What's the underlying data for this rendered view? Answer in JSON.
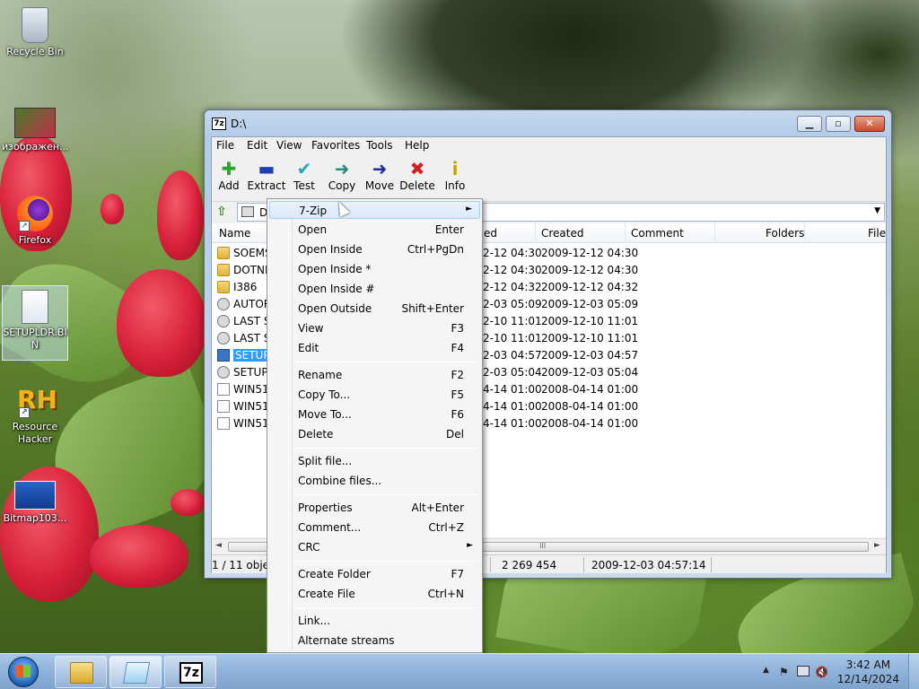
{
  "desktop": {
    "icons": [
      {
        "label": "Recycle Bin",
        "icon": "recycle-bin-icon"
      },
      {
        "label": "изображен...",
        "icon": "image-file-icon"
      },
      {
        "label": "Firefox",
        "icon": "firefox-icon"
      },
      {
        "label": "SETUPLDR.BIN",
        "icon": "bin-file-icon"
      },
      {
        "label": "Resource Hacker",
        "icon": "resource-hacker-icon"
      },
      {
        "label": "Bitmap103...",
        "icon": "bitmap-file-icon"
      }
    ],
    "resource_hacker_glyph": "RH"
  },
  "window": {
    "title": "D:\\",
    "app_icon_text": "7z",
    "menu": [
      "File",
      "Edit",
      "View",
      "Favorites",
      "Tools",
      "Help"
    ],
    "toolbar": [
      {
        "label": "Add",
        "icon": "add-icon",
        "glyph": "✚",
        "color": "#2fa32f"
      },
      {
        "label": "Extract",
        "icon": "extract-icon",
        "glyph": "▬",
        "color": "#1f3fb5"
      },
      {
        "label": "Test",
        "icon": "test-icon",
        "glyph": "✔",
        "color": "#26a6b8"
      },
      {
        "label": "Copy",
        "icon": "copy-icon",
        "glyph": "➜",
        "color": "#2a8a7a"
      },
      {
        "label": "Move",
        "icon": "move-icon",
        "glyph": "➜",
        "color": "#1f2f9a"
      },
      {
        "label": "Delete",
        "icon": "delete-icon",
        "glyph": "✖",
        "color": "#d21f1f"
      },
      {
        "label": "Info",
        "icon": "info-icon",
        "glyph": "i",
        "color": "#c7a300"
      }
    ],
    "address": {
      "path": "D",
      "dropdown": "▼"
    },
    "columns": [
      "Name",
      "ed",
      "Created",
      "Comment",
      "Folders",
      "File"
    ],
    "rows": [
      {
        "name": "SOEMS",
        "icon": "folder",
        "modified": "2-12 04:30",
        "created": "2009-12-12 04:30"
      },
      {
        "name": "DOTNE",
        "icon": "folder",
        "modified": "2-12 04:30",
        "created": "2009-12-12 04:30"
      },
      {
        "name": "I386",
        "icon": "folder",
        "modified": "2-12 04:32",
        "created": "2009-12-12 04:32"
      },
      {
        "name": "AUTOR",
        "icon": "gear",
        "modified": "2-03 05:09",
        "created": "2009-12-03 05:09"
      },
      {
        "name": "LAST SE",
        "icon": "gear",
        "modified": "2-10 11:01",
        "created": "2009-12-10 11:01"
      },
      {
        "name": "LAST SE",
        "icon": "gear",
        "modified": "2-10 11:01",
        "created": "2009-12-10 11:01"
      },
      {
        "name": "SETUP.E",
        "icon": "app",
        "modified": "2-03 04:57",
        "created": "2009-12-03 04:57",
        "selected": true
      },
      {
        "name": "SETUP.I",
        "icon": "gear",
        "modified": "2-03 05:04",
        "created": "2009-12-03 05:04"
      },
      {
        "name": "WIN51",
        "icon": "file",
        "modified": "4-14 01:00",
        "created": "2008-04-14 01:00"
      },
      {
        "name": "WIN51I",
        "icon": "file",
        "modified": "4-14 01:00",
        "created": "2008-04-14 01:00"
      },
      {
        "name": "WIN51I",
        "icon": "file",
        "modified": "4-14 01:00",
        "created": "2008-04-14 01:00"
      }
    ],
    "scroll_grip": "III",
    "status": {
      "selection": "1 / 11 objec",
      "size": "2 269 454",
      "modified": "2009-12-03 04:57:14"
    }
  },
  "context_menu": {
    "items": [
      {
        "type": "item",
        "label": "7-Zip",
        "submenu": true,
        "highlighted": true
      },
      {
        "type": "item",
        "label": "Open",
        "shortcut": "Enter"
      },
      {
        "type": "item",
        "label": "Open Inside",
        "shortcut": "Ctrl+PgDn"
      },
      {
        "type": "item",
        "label": "Open Inside *"
      },
      {
        "type": "item",
        "label": "Open Inside #"
      },
      {
        "type": "item",
        "label": "Open Outside",
        "shortcut": "Shift+Enter"
      },
      {
        "type": "item",
        "label": "View",
        "shortcut": "F3"
      },
      {
        "type": "item",
        "label": "Edit",
        "shortcut": "F4"
      },
      {
        "type": "sep"
      },
      {
        "type": "item",
        "label": "Rename",
        "shortcut": "F2"
      },
      {
        "type": "item",
        "label": "Copy To...",
        "shortcut": "F5"
      },
      {
        "type": "item",
        "label": "Move To...",
        "shortcut": "F6"
      },
      {
        "type": "item",
        "label": "Delete",
        "shortcut": "Del"
      },
      {
        "type": "sep"
      },
      {
        "type": "item",
        "label": "Split file..."
      },
      {
        "type": "item",
        "label": "Combine files..."
      },
      {
        "type": "sep"
      },
      {
        "type": "item",
        "label": "Properties",
        "shortcut": "Alt+Enter"
      },
      {
        "type": "item",
        "label": "Comment...",
        "shortcut": "Ctrl+Z"
      },
      {
        "type": "item",
        "label": "CRC",
        "submenu": true
      },
      {
        "type": "sep"
      },
      {
        "type": "item",
        "label": "Create Folder",
        "shortcut": "F7"
      },
      {
        "type": "item",
        "label": "Create File",
        "shortcut": "Ctrl+N"
      },
      {
        "type": "sep"
      },
      {
        "type": "item",
        "label": "Link..."
      },
      {
        "type": "item",
        "label": "Alternate streams"
      }
    ],
    "submenu_arrow": "►"
  },
  "taskbar": {
    "buttons": [
      {
        "name": "explorer",
        "icon": "folder-icon"
      },
      {
        "name": "active-app",
        "icon": "notepad-icon",
        "active": true
      },
      {
        "name": "7zip",
        "icon": "7zip-icon",
        "text": "7z"
      }
    ],
    "tray": {
      "chevron": "▲",
      "icons": [
        "flag-icon",
        "network-icon",
        "volume-muted-icon"
      ]
    },
    "clock": {
      "time": "3:42 AM",
      "date": "12/14/2024"
    }
  },
  "colors": {
    "accent": "#3399ff",
    "taskbar": "#8fb2da",
    "close": "#c74a2e"
  }
}
